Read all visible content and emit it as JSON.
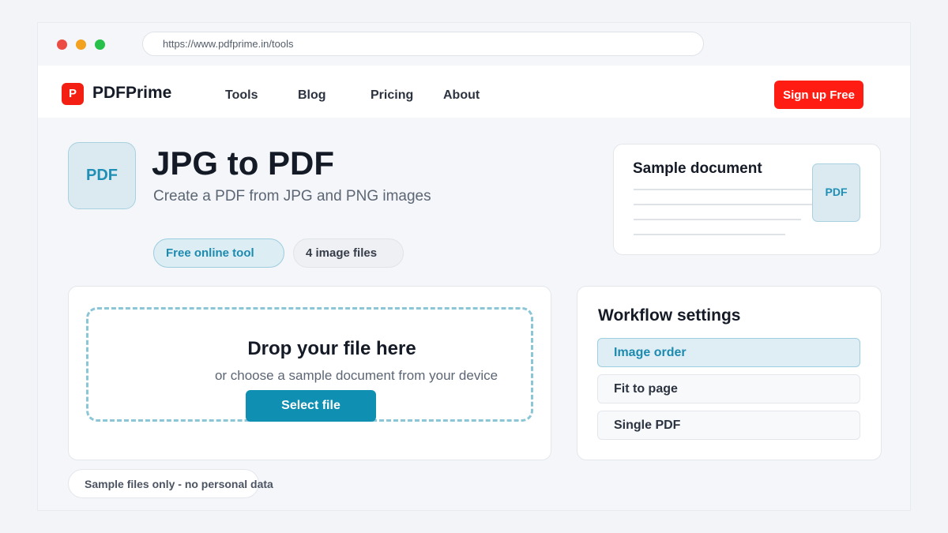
{
  "browser": {
    "url": "https://www.pdfprime.in/tools"
  },
  "navbar": {
    "logo_letter": "P",
    "brand": "PDFPrime",
    "links": [
      "Tools",
      "Blog",
      "Pricing",
      "About"
    ],
    "signup_label": "Sign up Free"
  },
  "tool": {
    "icon_label": "PDF",
    "title": "JPG to PDF",
    "subtitle": "Create a PDF from JPG and PNG images",
    "badges": [
      "Free online tool",
      "4 image files"
    ]
  },
  "sample": {
    "title": "Sample document",
    "badge": "PDF"
  },
  "upload": {
    "title": "Drop your file here",
    "subtitle": "or choose a sample document from your device",
    "button_label": "Select file"
  },
  "settings": {
    "title": "Workflow settings",
    "options": [
      "Image order",
      "Fit to page",
      "Single PDF"
    ],
    "selected": "Image order"
  },
  "privacy_note": "Sample files only - no personal data",
  "colors": {
    "brand_red": "#ff1d13",
    "accent_blue": "#0f8fb1"
  }
}
